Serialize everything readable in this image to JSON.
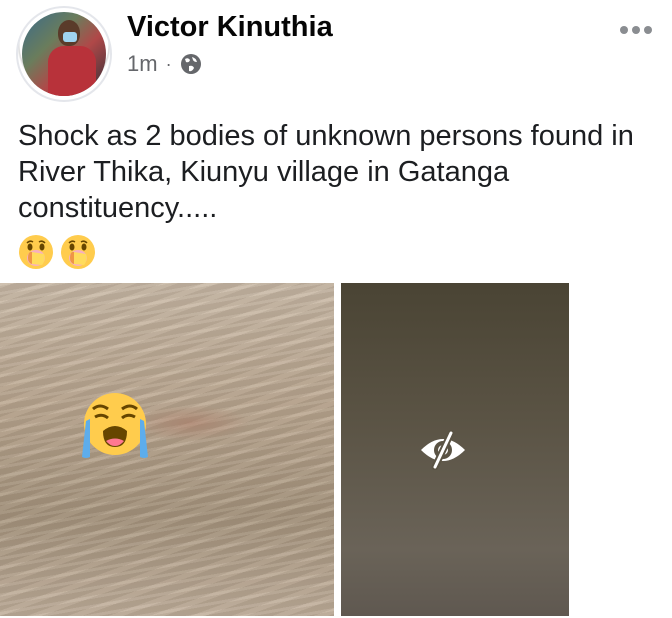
{
  "post": {
    "author": "Victor Kinuthia",
    "time": "1m",
    "separator": "·",
    "privacy_icon": "globe-icon",
    "more_icon": "more-options-icon",
    "text": "Shock as 2 bodies of unknown persons found in River Thika, Kiunyu village in Gatanga constituency.....",
    "emojis": [
      "face-with-hand-over-mouth",
      "face-with-hand-over-mouth"
    ],
    "photos": [
      {
        "overlay_icon": "loudly-crying-face-emoji"
      },
      {
        "overlay_icon": "eye-slash-icon",
        "hidden": true
      }
    ]
  },
  "colors": {
    "name": "#050505",
    "meta": "#65676b",
    "text": "#1c1e21",
    "emoji_yellow": "#ffcc4d"
  }
}
